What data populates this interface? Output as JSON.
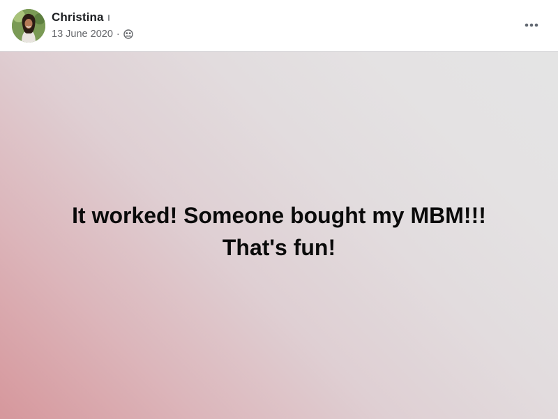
{
  "post": {
    "author": {
      "name": "Christina",
      "avatar_icon": "profile-photo"
    },
    "date": "13 June 2020",
    "separator": "·",
    "privacy_icon": "friends-icon",
    "more_icon": "more-options-icon",
    "body": {
      "line1": "It worked! Someone bought my MBM!!!",
      "line2": "That's fun!"
    },
    "colors": {
      "gradient_start": "#d6979c",
      "gradient_end": "#e4e4e4",
      "text": "#0a0a0a"
    }
  }
}
